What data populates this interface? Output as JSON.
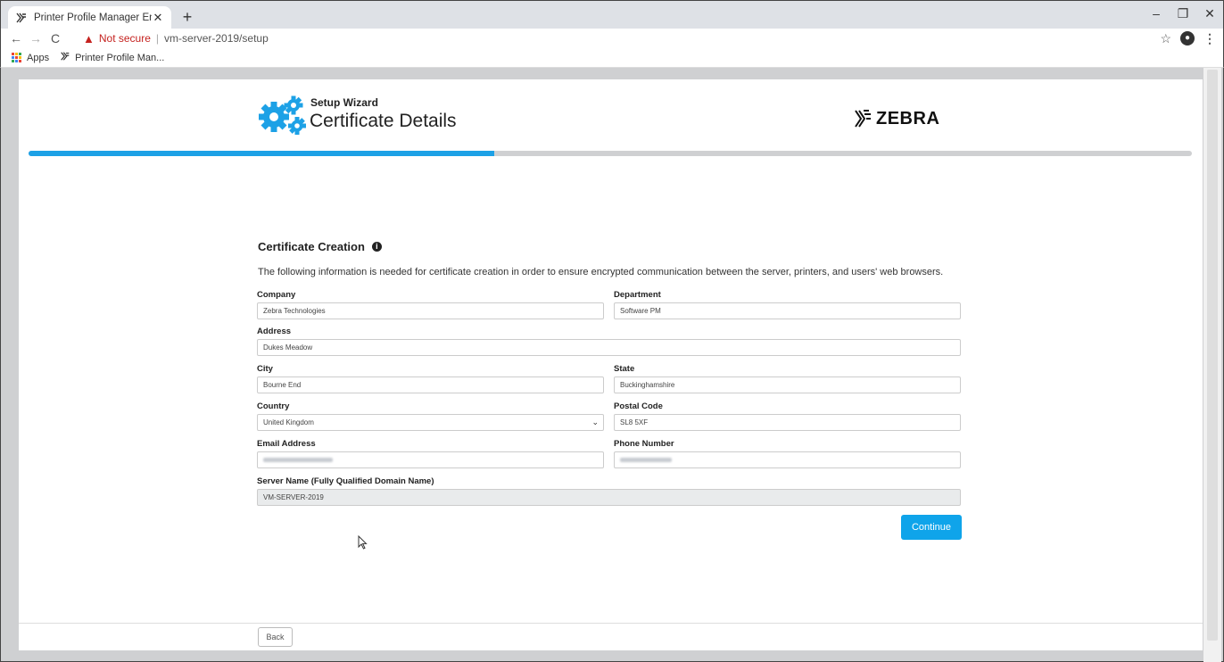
{
  "browser": {
    "tab_title": "Printer Profile Manager Enterpris",
    "tab_favicon": "zebra-icon",
    "new_tab": "+",
    "not_secure": "Not secure",
    "separator": "|",
    "url": "vm-server-2019/setup",
    "bookmarks": [
      {
        "label": "Apps",
        "icon": "apps-grid-icon"
      },
      {
        "label": "Printer Profile Man...",
        "icon": "zebra-icon"
      }
    ]
  },
  "header": {
    "subtitle": "Setup Wizard",
    "title": "Certificate Details",
    "brand": "ZEBRA",
    "progress_fraction": 0.4,
    "accent_color": "#1da1e6"
  },
  "form": {
    "section_title": "Certificate Creation",
    "description": "The following information is needed for certificate creation in order to ensure encrypted communication between the server, printers, and users' web browsers.",
    "company": {
      "label": "Company",
      "value": "Zebra Technologies"
    },
    "department": {
      "label": "Department",
      "value": "Software PM"
    },
    "address": {
      "label": "Address",
      "value": "Dukes Meadow"
    },
    "city": {
      "label": "City",
      "value": "Bourne End"
    },
    "state": {
      "label": "State",
      "value": "Buckinghamshire"
    },
    "country": {
      "label": "Country",
      "value": "United Kingdom"
    },
    "postal_code": {
      "label": "Postal Code",
      "value": "SL8 5XF"
    },
    "email": {
      "label": "Email Address"
    },
    "phone": {
      "label": "Phone Number"
    },
    "server_name": {
      "label": "Server Name (Fully Qualified Domain Name)",
      "value": "VM-SERVER-2019"
    },
    "continue_label": "Continue",
    "button_color": "#0fa4ea"
  },
  "footer": {
    "back_label": "Back"
  }
}
